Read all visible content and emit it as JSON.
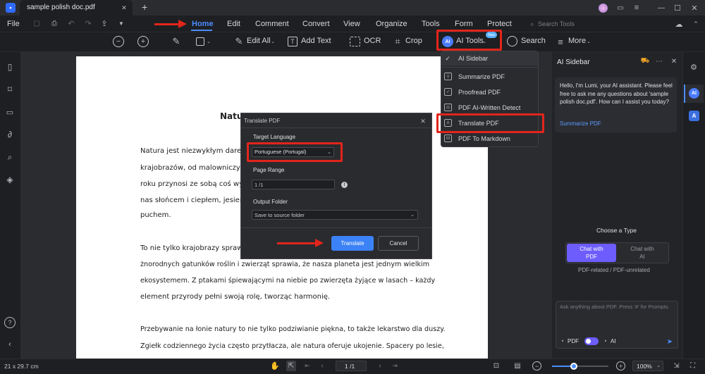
{
  "app": {
    "tab_title": "sample polish doc.pdf",
    "new_tab": "+"
  },
  "window": {
    "minimize": "—",
    "maximize": "☐",
    "close": "✕"
  },
  "menubar": {
    "file": "File",
    "items": [
      "Home",
      "Edit",
      "Comment",
      "Convert",
      "View",
      "Organize",
      "Tools",
      "Form",
      "Protect"
    ],
    "search_tools": "Search Tools"
  },
  "toolbar": {
    "edit_all": "Edit All",
    "add_text": "Add Text",
    "ocr": "OCR",
    "crop": "Crop",
    "ai_tools": "AI Tools",
    "ai_badge": "New",
    "search": "Search",
    "more": "More"
  },
  "ai_menu": {
    "items": [
      "AI Sidebar",
      "Summarize PDF",
      "Proofread PDF",
      "PDF AI-Written Detect",
      "Translate PDF",
      "PDF To Markdown"
    ]
  },
  "document": {
    "heading_partial": "Natu",
    "lines": [
      "Natura jest niezwykłym darem,",
      "krajobrazów, od malowniczych",
      "roku przynosi ze sobą coś wyjątk",
      "nas słońcem i ciepłem, jesień ma",
      "puchem.",
      "To nie tylko krajobrazy sprawia",
      "żnorodnych gatunków roślin i zwierząt sprawia, że nasza planeta jest jednym wielkim",
      "ekosystemem. Z ptakami śpiewającymi na niebie po zwierzęta żyjące w lasach – każdy",
      "element przyrody pełni swoją rolę, tworząc harmonię.",
      "Przebywanie na łonie natury to nie tylko podziwianie piękna, to także lekarstwo dla duszy.",
      "Zgiełk codziennego życia często przytłacza, ale natura oferuje ukojenie. Spacery po lesie,"
    ]
  },
  "dialog": {
    "title": "Translate PDF",
    "target_language_label": "Target Language",
    "target_language_value": "Portuguese (Portugal)",
    "page_range_label": "Page Range",
    "page_range_value": "1 /1",
    "output_folder_label": "Output Folder",
    "output_folder_value": "Save to source folder",
    "translate_button": "Translate",
    "cancel_button": "Cancel"
  },
  "sidebar": {
    "title": "AI Sidebar",
    "message": "Hello, I'm Lumi, your AI assistant. Please feel free to ask me any questions about 'sample polish doc.pdf'. How can I assist you today?",
    "summarize_link": "Summarize PDF",
    "choose_type": "Choose a Type",
    "chat_pdf": "Chat with PDF",
    "chat_ai": "Chat with AI",
    "type_caption": "PDF-related / PDF-unrelated",
    "input_placeholder": "Ask anything about PDF. Press '#' for Prompts.",
    "pdf_toggle": "PDF",
    "ai_toggle": "AI"
  },
  "statusbar": {
    "page_size": "21 x 29.7 cm",
    "page_indicator": "1 /1",
    "zoom": "100%"
  },
  "colors": {
    "accent": "#3b82f6",
    "highlight": "#e1251b",
    "sidebar_accent": "#6d5dfc"
  }
}
